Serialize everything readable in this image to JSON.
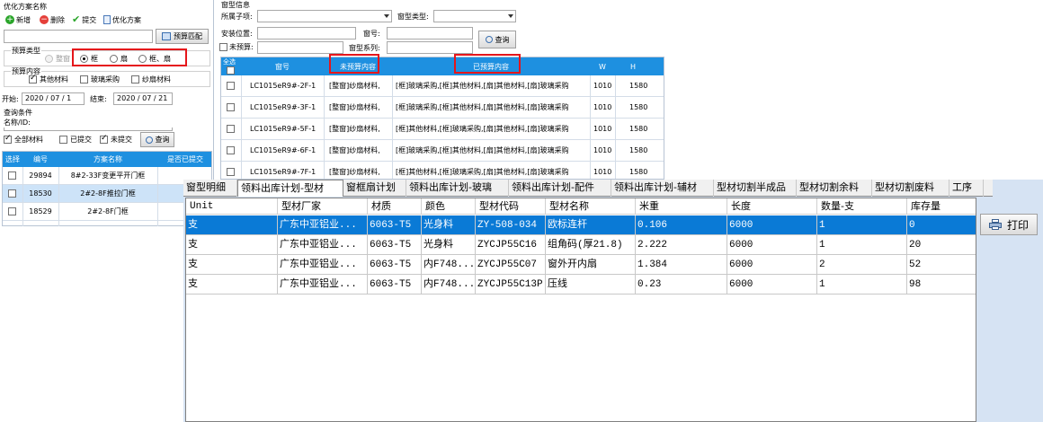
{
  "left_panel": {
    "title": "优化方案名称",
    "toolbar": {
      "new": "新增",
      "delete": "删除",
      "submit": "提交",
      "optimize": "优化方案"
    },
    "budget_match_btn": "预算匹配",
    "budget_type": {
      "label": "预算类型",
      "options": [
        "整窗",
        "框",
        "扇",
        "框、扇"
      ],
      "selected": "框"
    },
    "budget_content": {
      "label": "预算内容",
      "items": [
        "其他材料",
        "玻璃采购",
        "纱扇材料"
      ],
      "checked": [
        "其他材料"
      ]
    },
    "start_label": "开始:",
    "start_value": "2020 / 07 / 1",
    "end_label": "结束:",
    "end_value": "2020 / 07 / 21",
    "query_conditions": "查询条件",
    "name_id_label": "名称/ID:",
    "filters": {
      "all": "全部材料",
      "submitted": "已提交",
      "unsubmitted": "未提交",
      "query_btn": "查询"
    },
    "table": {
      "columns": [
        "选择",
        "编号",
        "方案名称",
        "是否已提交"
      ],
      "rows": [
        {
          "id": "29894",
          "name": "8#2-33F变更平开门框",
          "submitted": ""
        },
        {
          "id": "18530",
          "name": "2#2-8F推拉门框",
          "submitted": ""
        },
        {
          "id": "18529",
          "name": "2#2-8F门框",
          "submitted": ""
        }
      ]
    }
  },
  "right_panel": {
    "title": "窗型信息",
    "sub_item_label": "所属子项:",
    "window_type_label": "窗型类型:",
    "install_pos_label": "安装位置:",
    "window_no_label": "窗号:",
    "unbudgeted_label": "未预算:",
    "window_series_label": "窗型系列:",
    "query_btn": "查询",
    "table": {
      "select_all": "全选",
      "columns": [
        "窗号",
        "未预算内容",
        "已预算内容",
        "W",
        "H"
      ],
      "rows": [
        {
          "no": "LC1015eR9#-2F-1",
          "unbudgeted": "[整窗]纱扇材料,",
          "budgeted": "[框]玻璃采购,[框]其他材料,[扇]其他材料,[扇]玻璃采购",
          "w": "1010",
          "h": "1580"
        },
        {
          "no": "LC1015eR9#-3F-1",
          "unbudgeted": "[整窗]纱扇材料,",
          "budgeted": "[框]玻璃采购,[框]其他材料,[扇]其他材料,[扇]玻璃采购",
          "w": "1010",
          "h": "1580"
        },
        {
          "no": "LC1015eR9#-5F-1",
          "unbudgeted": "[整窗]纱扇材料,",
          "budgeted": "[框]其他材料,[框]玻璃采购,[扇]其他材料,[扇]玻璃采购",
          "w": "1010",
          "h": "1580"
        },
        {
          "no": "LC1015eR9#-6F-1",
          "unbudgeted": "[整窗]纱扇材料,",
          "budgeted": "[框]玻璃采购,[框]其他材料,[扇]其他材料,[扇]玻璃采购",
          "w": "1010",
          "h": "1580"
        },
        {
          "no": "LC1015eR9#-7F-1",
          "unbudgeted": "[整窗]纱扇材料,",
          "budgeted": "[框]其他材料,[框]玻璃采购,[扇]其他材料,[扇]玻璃采购",
          "w": "1010",
          "h": "1580"
        }
      ]
    }
  },
  "bottom_panel": {
    "tabs": [
      "窗型明细",
      "领料出库计划-型材",
      "窗框扇计划",
      "领料出库计划-玻璃",
      "领料出库计划-配件",
      "领料出库计划-辅材",
      "型材切割半成品",
      "型材切割余料",
      "型材切割废料",
      "工序"
    ],
    "active_tab": "领料出库计划-型材",
    "print_btn": "打印",
    "columns": [
      "Unit",
      "型材厂家",
      "材质",
      "颜色",
      "型材代码",
      "型材名称",
      "米重",
      "长度",
      "数量-支",
      "库存量"
    ],
    "rows": [
      [
        "支",
        "广东中亚铝业...",
        "6063-T5",
        "光身料",
        "ZY-508-034",
        "欧标连杆",
        "0.106",
        "6000",
        "1",
        "0"
      ],
      [
        "支",
        "广东中亚铝业...",
        "6063-T5",
        "光身料",
        "ZYCJP55C16",
        "组角码(厚21.8)",
        "2.222",
        "6000",
        "1",
        "20"
      ],
      [
        "支",
        "广东中亚铝业...",
        "6063-T5",
        "内F748...",
        "ZYCJP55C07",
        "窗外开内扇",
        "1.384",
        "6000",
        "2",
        "52"
      ],
      [
        "支",
        "广东中亚铝业...",
        "6063-T5",
        "内F748...",
        "ZYCJP55C13P",
        "压线",
        "0.23",
        "6000",
        "1",
        "98"
      ]
    ]
  },
  "colors": {
    "header_blue": "#1e90e0",
    "selected_row": "#0a7ad6",
    "highlight_red": "#e5161b",
    "right_bg": "#d6e3f3"
  }
}
